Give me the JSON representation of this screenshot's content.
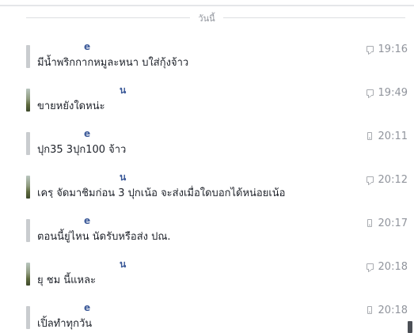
{
  "day_divider": "วันนี้",
  "messages": [
    {
      "sender": "e",
      "text": "มีน้ำพริกกากหมูละหนา บใส่กุ้งจ้าว",
      "time": "19:16",
      "via": "chat-icon"
    },
    {
      "sender": "น",
      "text": "ขายหยังใดหน่ะ",
      "time": "19:49",
      "via": "chat-icon"
    },
    {
      "sender": "e",
      "text": "ปุก35  3ปุก100 จ้าว",
      "time": "20:11",
      "via": "mobile-phone-icon"
    },
    {
      "sender": "น",
      "text": "เครฺ จัดมาชิมก่อน 3 ปุกเน้อ จะส่งเมื่อใดบอกได้หน่อยเน้อ",
      "time": "20:12",
      "via": "chat-icon"
    },
    {
      "sender": "e",
      "text": "ตอนนี้ยู่ไหน นัดรับหรือส่ง ปณ.",
      "time": "20:17",
      "via": "mobile-phone-icon"
    },
    {
      "sender": "น",
      "text": "ยุ ชม นี้แหละ",
      "time": "20:18",
      "via": "chat-icon"
    },
    {
      "sender": "e",
      "text": "เปิ้ลทำทุกวัน",
      "time": "20:18",
      "via": "mobile-phone-icon"
    }
  ]
}
